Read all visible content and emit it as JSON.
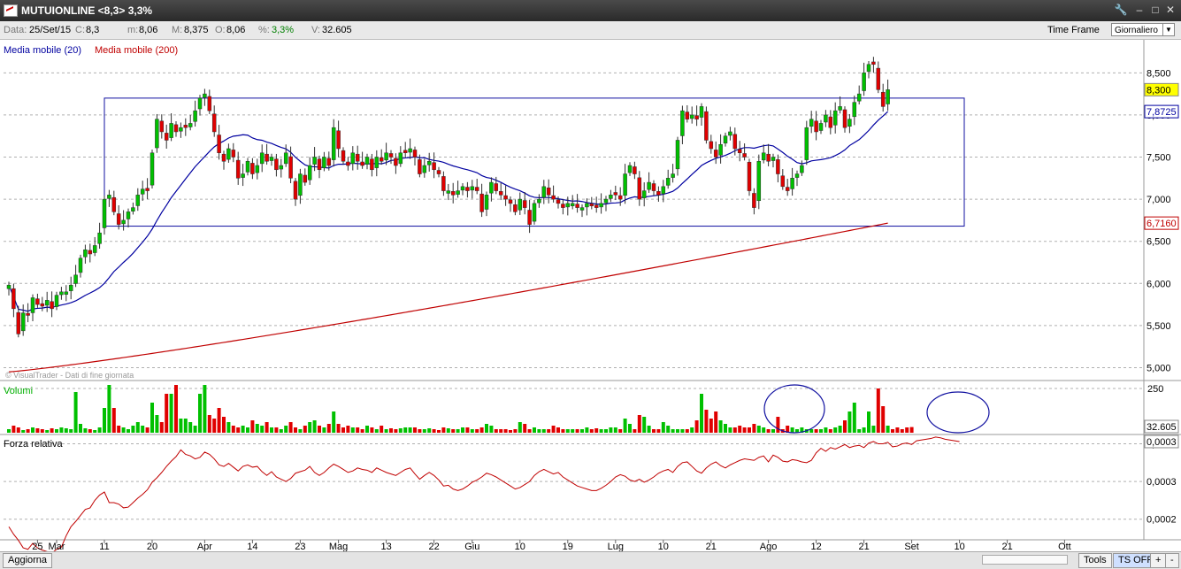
{
  "window": {
    "title": "MUTUIONLINE <8,3> 3,3%"
  },
  "info": {
    "data_label": "Data:",
    "data_value": "25/Set/15",
    "c_label": "C:",
    "c_value": "8,3",
    "m_label": "m:",
    "m_value": "8,06",
    "M_label": "M:",
    "M_value": "8,375",
    "o_label": "O:",
    "o_value": "8,06",
    "pct_label": "%:",
    "pct_value": "3,3%",
    "v_label": "V:",
    "v_value": "32.605",
    "timeframe_label": "Time Frame",
    "timeframe_value": "Giornaliero"
  },
  "bottom": {
    "aggiorna": "Aggiorna",
    "tools": "Tools",
    "ts_off": "TS OFF",
    "plus": "+",
    "minus": "-"
  },
  "colors": {
    "up": "#00c000",
    "down": "#e00000",
    "ma20": "#0000a0",
    "ma200": "#c00000",
    "rs": "#c00000",
    "grid": "#b0b0b0"
  },
  "chart_data": [
    {
      "type": "candlestick",
      "legend": [
        "Media mobile (20)",
        "Media mobile (200)"
      ],
      "watermark": "© VisualTrader - Dati di fine giornata",
      "ylim": [
        4.9,
        8.85
      ],
      "yticks": [
        5.0,
        5.5,
        6.0,
        6.5,
        7.0,
        7.5,
        8.0,
        8.5
      ],
      "ytick_labels": [
        "5,000",
        "5,500",
        "6,000",
        "6,500",
        "7,000",
        "7,500",
        "8,000",
        "8,500"
      ],
      "last_price_label": "8,300",
      "ma20_label": "7,8725",
      "ma200_label": "6,7160",
      "rectangle": {
        "start_index": 20,
        "end_index": 200,
        "top": 8.2,
        "bottom": 6.68
      },
      "x_labels": [
        {
          "i": 6,
          "t": "25"
        },
        {
          "i": 10,
          "t": "Mar"
        },
        {
          "i": 20,
          "t": "11"
        },
        {
          "i": 30,
          "t": "20"
        },
        {
          "i": 41,
          "t": "Apr"
        },
        {
          "i": 51,
          "t": "14"
        },
        {
          "i": 61,
          "t": "23"
        },
        {
          "i": 69,
          "t": "Mag"
        },
        {
          "i": 79,
          "t": "13"
        },
        {
          "i": 89,
          "t": "22"
        },
        {
          "i": 97,
          "t": "Giu"
        },
        {
          "i": 107,
          "t": "10"
        },
        {
          "i": 117,
          "t": "19"
        },
        {
          "i": 127,
          "t": "Lug"
        },
        {
          "i": 137,
          "t": "10"
        },
        {
          "i": 147,
          "t": "21"
        },
        {
          "i": 159,
          "t": "Ago"
        },
        {
          "i": 169,
          "t": "12"
        },
        {
          "i": 179,
          "t": "21"
        },
        {
          "i": 189,
          "t": "Set"
        },
        {
          "i": 199,
          "t": "10"
        },
        {
          "i": 209,
          "t": "21"
        },
        {
          "i": 221,
          "t": "Ott"
        }
      ],
      "closes": [
        5.98,
        5.7,
        5.4,
        5.65,
        5.62,
        5.83,
        5.75,
        5.73,
        5.8,
        5.7,
        5.86,
        5.9,
        5.9,
        5.98,
        6.1,
        6.3,
        6.4,
        6.35,
        6.45,
        6.6,
        7.0,
        7.05,
        6.85,
        6.7,
        6.75,
        6.85,
        6.9,
        7.05,
        7.12,
        7.1,
        7.55,
        7.95,
        7.8,
        7.7,
        7.9,
        7.8,
        7.85,
        7.85,
        7.9,
        8.05,
        8.2,
        8.25,
        8.05,
        7.8,
        7.55,
        7.45,
        7.6,
        7.5,
        7.25,
        7.3,
        7.45,
        7.3,
        7.4,
        7.55,
        7.45,
        7.5,
        7.35,
        7.4,
        7.55,
        7.25,
        7.0,
        7.3,
        7.2,
        7.4,
        7.5,
        7.35,
        7.5,
        7.4,
        7.85,
        7.6,
        7.45,
        7.4,
        7.55,
        7.45,
        7.4,
        7.5,
        7.35,
        7.5,
        7.45,
        7.55,
        7.5,
        7.4,
        7.55,
        7.55,
        7.6,
        7.5,
        7.3,
        7.4,
        7.45,
        7.35,
        7.3,
        7.1,
        7.1,
        7.05,
        7.1,
        7.15,
        7.1,
        7.15,
        7.1,
        6.85,
        7.05,
        7.2,
        7.1,
        7.05,
        7.0,
        6.95,
        6.85,
        7.0,
        6.9,
        6.7,
        6.95,
        7.0,
        7.15,
        7.05,
        7.0,
        6.95,
        6.9,
        6.95,
        6.95,
        6.9,
        6.9,
        6.95,
        6.92,
        6.9,
        6.95,
        7.0,
        7.05,
        7.05,
        7.0,
        7.3,
        7.4,
        7.3,
        7.0,
        7.1,
        7.2,
        7.1,
        7.05,
        7.15,
        7.25,
        7.3,
        7.7,
        8.05,
        7.95,
        8.0,
        7.95,
        8.1,
        7.7,
        7.6,
        7.5,
        7.65,
        7.75,
        7.8,
        7.6,
        7.55,
        7.5,
        7.1,
        6.9,
        7.45,
        7.55,
        7.45,
        7.5,
        7.3,
        7.15,
        7.1,
        7.25,
        7.3,
        7.4,
        7.85,
        7.95,
        7.8,
        7.9,
        8.0,
        7.85,
        8.05,
        8.1,
        7.85,
        7.95,
        8.15,
        8.25,
        8.5,
        8.6,
        8.6,
        8.3,
        8.1,
        8.3
      ],
      "vol_ylim": [
        0,
        270
      ],
      "vol_tick": 250,
      "vol_last_label": "32.605",
      "volumes": [
        20,
        40,
        30,
        15,
        20,
        30,
        25,
        20,
        15,
        25,
        20,
        30,
        25,
        20,
        230,
        50,
        25,
        20,
        15,
        30,
        140,
        270,
        140,
        40,
        30,
        20,
        40,
        60,
        40,
        30,
        170,
        100,
        60,
        220,
        220,
        270,
        80,
        80,
        60,
        40,
        220,
        270,
        100,
        80,
        140,
        90,
        60,
        40,
        30,
        40,
        30,
        70,
        50,
        40,
        60,
        30,
        30,
        20,
        40,
        60,
        30,
        20,
        40,
        60,
        70,
        40,
        30,
        50,
        120,
        50,
        30,
        40,
        30,
        30,
        20,
        40,
        30,
        20,
        40,
        20,
        25,
        20,
        25,
        30,
        30,
        30,
        20,
        20,
        25,
        20,
        15,
        30,
        25,
        20,
        20,
        30,
        30,
        20,
        20,
        30,
        50,
        40,
        20,
        20,
        20,
        15,
        20,
        60,
        50,
        20,
        30,
        20,
        20,
        20,
        40,
        30,
        20,
        20,
        20,
        20,
        20,
        30,
        20,
        25,
        20,
        20,
        30,
        30,
        20,
        80,
        50,
        20,
        100,
        90,
        40,
        20,
        20,
        60,
        40,
        20,
        20,
        20,
        20,
        30,
        70,
        220,
        130,
        80,
        120,
        70,
        50,
        30,
        30,
        40,
        30,
        30,
        50,
        40,
        30,
        20,
        20,
        90,
        20,
        40,
        30,
        20,
        30,
        20,
        20,
        20,
        20,
        30,
        20,
        30,
        40,
        70,
        120,
        170,
        20,
        30,
        120,
        40,
        250,
        150,
        40,
        20,
        30,
        20,
        30,
        32
      ]
    },
    {
      "type": "line",
      "title": "Forza relativa",
      "ylim": [
        0.000175,
        0.00031
      ],
      "yticks": [
        0.0002,
        0.00025,
        0.0003
      ],
      "ytick_labels": [
        "0,0002",
        "0,0003",
        "0,0003"
      ],
      "last_label": "0,0003",
      "values": [
        0.00019,
        0.00018,
        0.000172,
        0.000162,
        0.00016,
        0.000168,
        0.000162,
        0.000159,
        0.000157,
        0.000155,
        0.00016,
        0.000163,
        0.000178,
        0.00019,
        0.000197,
        0.000205,
        0.000213,
        0.000215,
        0.000225,
        0.000232,
        0.000236,
        0.000222,
        0.000222,
        0.00022,
        0.000215,
        0.000216,
        0.000222,
        0.000228,
        0.000233,
        0.000239,
        0.000249,
        0.000255,
        0.000262,
        0.00027,
        0.000277,
        0.000283,
        0.000292,
        0.000286,
        0.000284,
        0.00028,
        0.000282,
        0.000289,
        0.000286,
        0.00028,
        0.000272,
        0.00027,
        0.000274,
        0.000269,
        0.000264,
        0.00027,
        0.000272,
        0.000269,
        0.00027,
        0.000263,
        0.000258,
        0.000263,
        0.000256,
        0.000253,
        0.00025,
        0.000254,
        0.000261,
        0.000263,
        0.000265,
        0.00027,
        0.000262,
        0.000258,
        0.000262,
        0.000268,
        0.000273,
        0.00027,
        0.000266,
        0.000262,
        0.000264,
        0.000268,
        0.000266,
        0.000265,
        0.000262,
        0.000268,
        0.000265,
        0.000262,
        0.00026,
        0.000258,
        0.000262,
        0.000266,
        0.000268,
        0.00026,
        0.000253,
        0.000258,
        0.000262,
        0.000258,
        0.000252,
        0.000244,
        0.000245,
        0.00024,
        0.000238,
        0.00024,
        0.000244,
        0.000249,
        0.000252,
        0.000256,
        0.000261,
        0.000259,
        0.000256,
        0.000252,
        0.000248,
        0.000244,
        0.00024,
        0.000242,
        0.000246,
        0.00025,
        0.000258,
        0.000263,
        0.000266,
        0.000263,
        0.00026,
        0.000262,
        0.000256,
        0.000252,
        0.000248,
        0.000244,
        0.000242,
        0.00024,
        0.000238,
        0.000238,
        0.000241,
        0.000245,
        0.00025,
        0.000256,
        0.000259,
        0.000257,
        0.000252,
        0.00025,
        0.000253,
        0.000249,
        0.000252,
        0.000256,
        0.000261,
        0.000264,
        0.000266,
        0.000262,
        0.00027,
        0.000275,
        0.000276,
        0.00027,
        0.000264,
        0.000261,
        0.000268,
        0.000273,
        0.000276,
        0.000271,
        0.000268,
        0.000272,
        0.000275,
        0.000278,
        0.00028,
        0.000279,
        0.000278,
        0.000282,
        0.000284,
        0.000276,
        0.000285,
        0.000282,
        0.000277,
        0.000276,
        0.000279,
        0.000278,
        0.000276,
        0.000275,
        0.000278,
        0.000288,
        0.000294,
        0.00029,
        0.000295,
        0.000293,
        0.000296,
        0.000299,
        0.000295,
        0.000297,
        0.000298,
        0.000295,
        0.000301,
        0.000303,
        0.0003,
        0.0003,
        0.000302,
        0.000296,
        0.000297,
        0.0003,
        0.000301,
        0.000299,
        0.000304,
        0.000305,
        0.000306,
        0.000307,
        0.000309,
        0.000308,
        0.000306,
        0.000305,
        0.000304,
        0.000303
      ]
    }
  ]
}
